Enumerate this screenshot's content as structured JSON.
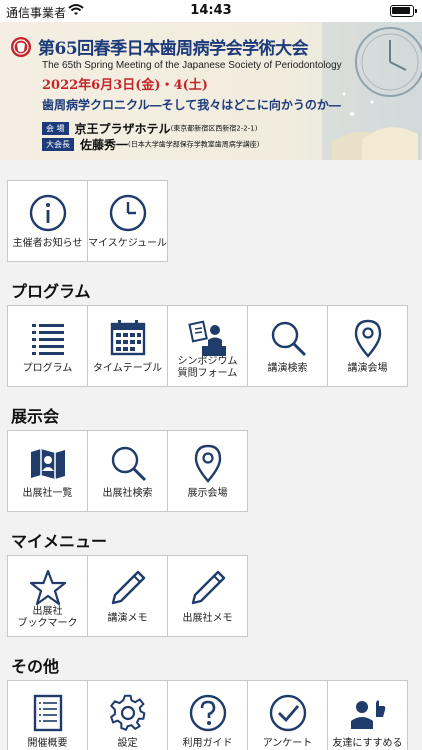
{
  "status": {
    "carrier": "通信事業者",
    "time": "14:43"
  },
  "banner": {
    "title": "第65回春季日本歯周病学会学術大会",
    "subtitle_en": "The 65th Spring Meeting of the Japanese Society of Periodontology",
    "date": "2022年6月3日(金)・4(土)",
    "theme": "歯周病学クロニクル―そして我々はどこに向かうのか―",
    "venue_tag": "会 場",
    "venue": "京王プラザホテル",
    "venue_addr": "(東京都新宿区西新宿2-2-1)",
    "chair_tag": "大会長",
    "chair": "佐藤秀一",
    "chair_aff": "(日本大学歯学部保存学教室歯周病学講座)"
  },
  "top_menu": [
    {
      "label": "主催者お知らせ",
      "icon": "info-icon"
    },
    {
      "label": "マイスケジュール",
      "icon": "clock-icon"
    }
  ],
  "sections": {
    "program": {
      "title": "プログラム",
      "items": [
        {
          "label": "プログラム",
          "icon": "list-icon"
        },
        {
          "label": "タイムテーブル",
          "icon": "calendar-icon"
        },
        {
          "label": "シンポジウム\n質問フォーム",
          "icon": "presenter-icon"
        },
        {
          "label": "講演検索",
          "icon": "search-icon"
        },
        {
          "label": "講演会場",
          "icon": "map-pin-icon"
        }
      ]
    },
    "exhibit": {
      "title": "展示会",
      "items": [
        {
          "label": "出展社一覧",
          "icon": "map-icon"
        },
        {
          "label": "出展社検索",
          "icon": "search-icon"
        },
        {
          "label": "展示会場",
          "icon": "map-pin-icon"
        }
      ]
    },
    "mymenu": {
      "title": "マイメニュー",
      "items": [
        {
          "label": "出展社\nブックマーク",
          "icon": "star-icon"
        },
        {
          "label": "講演メモ",
          "icon": "pencil-icon"
        },
        {
          "label": "出展社メモ",
          "icon": "pencil-icon"
        }
      ]
    },
    "other": {
      "title": "その他",
      "items": [
        {
          "label": "開催概要",
          "icon": "document-icon"
        },
        {
          "label": "設定",
          "icon": "gear-icon"
        },
        {
          "label": "利用ガイド",
          "icon": "help-icon"
        },
        {
          "label": "アンケート",
          "icon": "check-icon"
        },
        {
          "label": "友達にすすめる",
          "icon": "recommend-icon"
        }
      ]
    }
  },
  "colors": {
    "icon": "#1f3c6b",
    "title_blue": "#1d3b7a",
    "date_red": "#c3262a"
  }
}
